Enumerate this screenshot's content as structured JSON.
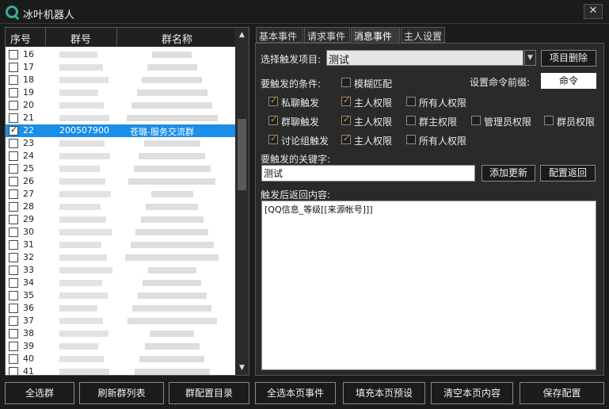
{
  "window": {
    "title": "冰叶机器人",
    "close_glyph": "✕"
  },
  "list": {
    "columns": [
      "序号",
      "群号",
      "群名称"
    ],
    "rows": [
      {
        "num": "16",
        "checked": false,
        "group_id": "",
        "name": ""
      },
      {
        "num": "17",
        "checked": false,
        "group_id": "",
        "name": ""
      },
      {
        "num": "18",
        "checked": false,
        "group_id": "",
        "name": ""
      },
      {
        "num": "19",
        "checked": false,
        "group_id": "",
        "name": ""
      },
      {
        "num": "20",
        "checked": false,
        "group_id": "",
        "name": ""
      },
      {
        "num": "21",
        "checked": false,
        "group_id": "",
        "name": ""
      },
      {
        "num": "22",
        "checked": true,
        "group_id": "200507900",
        "name": "苍璐-服务交流群",
        "selected": true
      },
      {
        "num": "23",
        "checked": false,
        "group_id": "",
        "name": ""
      },
      {
        "num": "24",
        "checked": false,
        "group_id": "",
        "name": ""
      },
      {
        "num": "25",
        "checked": false,
        "group_id": "",
        "name": ""
      },
      {
        "num": "26",
        "checked": false,
        "group_id": "",
        "name": ""
      },
      {
        "num": "27",
        "checked": false,
        "group_id": "",
        "name": ""
      },
      {
        "num": "28",
        "checked": false,
        "group_id": "",
        "name": ""
      },
      {
        "num": "29",
        "checked": false,
        "group_id": "",
        "name": ""
      },
      {
        "num": "30",
        "checked": false,
        "group_id": "",
        "name": ""
      },
      {
        "num": "31",
        "checked": false,
        "group_id": "",
        "name": ""
      },
      {
        "num": "32",
        "checked": false,
        "group_id": "",
        "name": ""
      },
      {
        "num": "33",
        "checked": false,
        "group_id": "",
        "name": ""
      },
      {
        "num": "34",
        "checked": false,
        "group_id": "",
        "name": ""
      },
      {
        "num": "35",
        "checked": false,
        "group_id": "",
        "name": ""
      },
      {
        "num": "36",
        "checked": false,
        "group_id": "",
        "name": ""
      },
      {
        "num": "37",
        "checked": false,
        "group_id": "",
        "name": ""
      },
      {
        "num": "38",
        "checked": false,
        "group_id": "",
        "name": ""
      },
      {
        "num": "39",
        "checked": false,
        "group_id": "",
        "name": ""
      },
      {
        "num": "40",
        "checked": false,
        "group_id": "",
        "name": ""
      },
      {
        "num": "41",
        "checked": false,
        "group_id": "",
        "name": ""
      }
    ]
  },
  "tabs": [
    "基本事件",
    "请求事件",
    "消息事件",
    "主人设置"
  ],
  "active_tab": "消息事件",
  "event": {
    "select_label": "选择触发项目:",
    "select_value": "测试",
    "delete_button": "项目删除",
    "condition_label": "要触发的条件:",
    "fuzzy_label": "模糊匹配",
    "fuzzy_checked": false,
    "prefix_label": "设置命令前缀:",
    "prefix_value": "命令",
    "rows": [
      {
        "trigger": "私聊触发",
        "trigger_on": true,
        "opts": [
          {
            "label": "主人权限",
            "on": true
          },
          {
            "label": "所有人权限",
            "on": false
          }
        ]
      },
      {
        "trigger": "群聊触发",
        "trigger_on": true,
        "opts": [
          {
            "label": "主人权限",
            "on": true
          },
          {
            "label": "群主权限",
            "on": false
          },
          {
            "label": "管理员权限",
            "on": false
          },
          {
            "label": "群员权限",
            "on": false
          }
        ]
      },
      {
        "trigger": "讨论组触发",
        "trigger_on": true,
        "opts": [
          {
            "label": "主人权限",
            "on": true
          },
          {
            "label": "所有人权限",
            "on": false
          }
        ]
      }
    ],
    "keyword_label": "要触发的关键字:",
    "keyword_value": "测试",
    "add_button": "添加更新",
    "reset_button": "配置返回",
    "reply_label": "触发后返回内容:",
    "reply_value": "[QQ信息_等级[[来源帐号]]]"
  },
  "bottom_buttons": [
    "全选群",
    "刷新群列表",
    "群配置目录",
    "全选本页事件",
    "填充本页预设",
    "清空本页内容",
    "保存配置"
  ],
  "colors": {
    "selection": "#1a8ee8",
    "check_accent": "#ff8a1d",
    "logo": "#2fb0a0"
  }
}
